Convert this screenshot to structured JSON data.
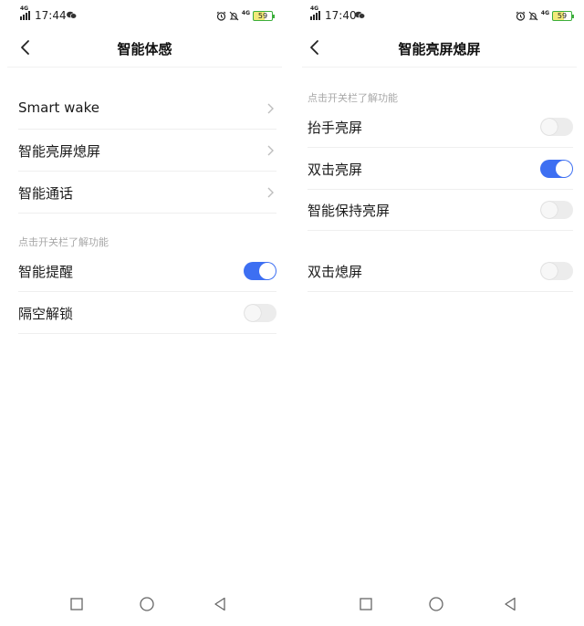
{
  "left": {
    "status": {
      "time": "17:44",
      "network": "4G",
      "network2": "4G",
      "battery": "59"
    },
    "title": "智能体感",
    "nav_items": [
      {
        "label": "Smart wake"
      },
      {
        "label": "智能亮屏熄屏"
      },
      {
        "label": "智能通话"
      }
    ],
    "section_hint": "点击开关栏了解功能",
    "toggles": [
      {
        "label": "智能提醒",
        "on": true
      },
      {
        "label": "隔空解锁",
        "on": false
      }
    ]
  },
  "right": {
    "status": {
      "time": "17:40",
      "network": "4G",
      "network2": "4G",
      "battery": "59"
    },
    "title": "智能亮屏熄屏",
    "section_hint": "点击开关栏了解功能",
    "toggles": [
      {
        "label": "抬手亮屏",
        "on": false
      },
      {
        "label": "双击亮屏",
        "on": true
      },
      {
        "label": "智能保持亮屏",
        "on": false
      },
      {
        "label": "双击熄屏",
        "on": false
      }
    ]
  },
  "colors": {
    "toggle_on": "#3d6ff2",
    "toggle_off": "#ececec",
    "hint": "#a8a8a8"
  },
  "icons": {
    "back": "chevron-left-icon",
    "nav": [
      "square-recents-icon",
      "circle-home-icon",
      "triangle-back-icon"
    ]
  }
}
